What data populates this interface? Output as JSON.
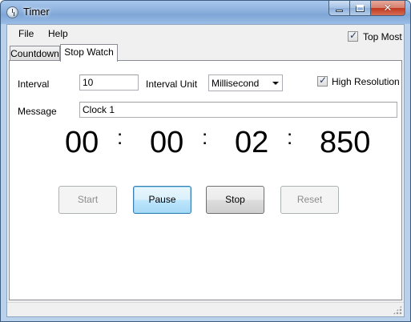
{
  "window": {
    "title": "Timer",
    "close_glyph": "✕"
  },
  "menu": {
    "items": [
      "File",
      "Help"
    ]
  },
  "top_most": {
    "label": "Top Most",
    "checked": true
  },
  "tabs": [
    {
      "label": "Countdown",
      "active": false
    },
    {
      "label": "Stop Watch",
      "active": true
    }
  ],
  "form": {
    "interval_label": "Interval",
    "interval_value": "10",
    "interval_unit_label": "Interval Unit",
    "interval_unit_value": "Millisecond",
    "high_resolution": {
      "label": "High Resolution",
      "checked": true
    },
    "message_label": "Message",
    "message_value": "Clock 1"
  },
  "clock": {
    "hours": "00",
    "minutes": "00",
    "seconds": "02",
    "milliseconds": "850",
    "separator": ":"
  },
  "buttons": {
    "start": {
      "label": "Start",
      "enabled": false
    },
    "pause": {
      "label": "Pause",
      "enabled": true
    },
    "stop": {
      "label": "Stop",
      "enabled": true
    },
    "reset": {
      "label": "Reset",
      "enabled": false
    }
  },
  "icons": {
    "app": "stopwatch-icon",
    "minimize": "minimize-icon",
    "maximize": "maximize-icon",
    "close": "close-icon",
    "dropdown": "chevron-down-icon",
    "resize_grip": "resize-grip-icon"
  }
}
